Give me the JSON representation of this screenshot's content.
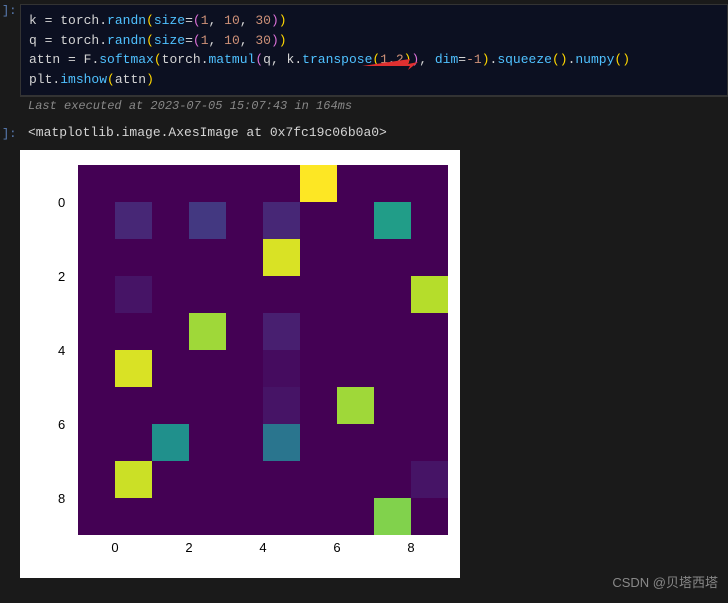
{
  "prompt_in": "]:",
  "prompt_out": "]:",
  "code": {
    "line1": {
      "k": "k",
      "eq": " = ",
      "torch": "torch",
      "dot": ".",
      "randn": "randn",
      "lp": "(",
      "size": "size",
      "eq2": "=",
      "lp2": "(",
      "n1": "1",
      "c1": ", ",
      "n2": "10",
      "c2": ", ",
      "n3": "30",
      "rp2": ")",
      "rp": ")"
    },
    "line2": {
      "k": "q",
      "eq": " = ",
      "torch": "torch",
      "dot": ".",
      "randn": "randn",
      "lp": "(",
      "size": "size",
      "eq2": "=",
      "lp2": "(",
      "n1": "1",
      "c1": ", ",
      "n2": "10",
      "c2": ", ",
      "n3": "30",
      "rp2": ")",
      "rp": ")"
    },
    "line3": {
      "attn": "attn",
      "eq": " = ",
      "F": "F",
      "dot": ".",
      "softmax": "softmax",
      "lp": "(",
      "torch": "torch",
      "dot2": ".",
      "matmul": "matmul",
      "lp2": "(",
      "q": "q",
      "c1": ", ",
      "k": "k",
      "dot3": ".",
      "transpose": "transpose",
      "lp3": "(",
      "n1": "1",
      "c2": ",",
      "n2": "2",
      "rp3": ")",
      "rp2": ")",
      "c3": ", ",
      "dim": "dim",
      "eq2": "=",
      "neg1": "-1",
      "rp": ")",
      "dot4": ".",
      "squeeze": "squeeze",
      "lp4": "(",
      "rp4": ")",
      "dot5": ".",
      "numpy": "numpy",
      "lp5": "(",
      "rp5": ")"
    },
    "line4": {
      "plt": "plt",
      "dot": ".",
      "imshow": "imshow",
      "lp": "(",
      "attn": "attn",
      "rp": ")"
    }
  },
  "exec_info": "Last executed at 2023-07-05 15:07:43 in 164ms",
  "output_repr": "<matplotlib.image.AxesImage at 0x7fc19c06b0a0>",
  "chart_data": {
    "type": "heatmap",
    "title": "",
    "xlabel": "",
    "ylabel": "",
    "x_ticks": [
      "0",
      "2",
      "4",
      "6",
      "8"
    ],
    "y_ticks": [
      "0",
      "2",
      "4",
      "6",
      "8"
    ],
    "xlim": [
      -0.5,
      9.5
    ],
    "ylim": [
      9.5,
      -0.5
    ],
    "colormap": "viridis",
    "grid_size": [
      10,
      10
    ],
    "values": [
      [
        0.05,
        0.05,
        0.05,
        0.05,
        0.05,
        0.05,
        0.95,
        0.05,
        0.05,
        0.05
      ],
      [
        0.05,
        0.15,
        0.05,
        0.2,
        0.05,
        0.15,
        0.05,
        0.05,
        0.55,
        0.05
      ],
      [
        0.05,
        0.05,
        0.05,
        0.05,
        0.05,
        0.9,
        0.05,
        0.05,
        0.05,
        0.05
      ],
      [
        0.05,
        0.1,
        0.05,
        0.05,
        0.05,
        0.05,
        0.05,
        0.05,
        0.05,
        0.85
      ],
      [
        0.05,
        0.05,
        0.05,
        0.82,
        0.05,
        0.13,
        0.05,
        0.05,
        0.05,
        0.05
      ],
      [
        0.05,
        0.9,
        0.05,
        0.05,
        0.05,
        0.08,
        0.05,
        0.05,
        0.05,
        0.05
      ],
      [
        0.05,
        0.05,
        0.05,
        0.05,
        0.05,
        0.1,
        0.05,
        0.82,
        0.05,
        0.05
      ],
      [
        0.05,
        0.05,
        0.5,
        0.05,
        0.05,
        0.4,
        0.05,
        0.05,
        0.05,
        0.05
      ],
      [
        0.05,
        0.88,
        0.05,
        0.05,
        0.05,
        0.05,
        0.05,
        0.05,
        0.05,
        0.1
      ],
      [
        0.05,
        0.05,
        0.05,
        0.05,
        0.05,
        0.05,
        0.05,
        0.05,
        0.78,
        0.05
      ]
    ]
  },
  "watermark": "CSDN @贝塔西塔"
}
